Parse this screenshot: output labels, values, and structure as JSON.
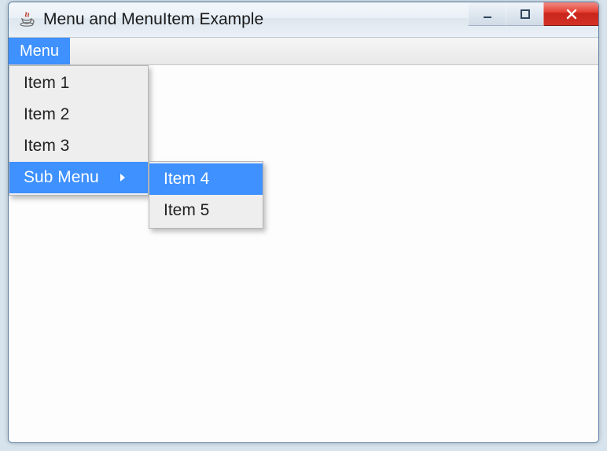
{
  "window": {
    "title": "Menu and MenuItem Example"
  },
  "menubar": {
    "menu_label": "Menu"
  },
  "main_popup": {
    "items": [
      {
        "label": "Item 1"
      },
      {
        "label": "Item 2"
      },
      {
        "label": "Item 3"
      },
      {
        "label": "Sub Menu"
      }
    ]
  },
  "sub_popup": {
    "items": [
      {
        "label": "Item 4"
      },
      {
        "label": "Item 5"
      }
    ]
  }
}
